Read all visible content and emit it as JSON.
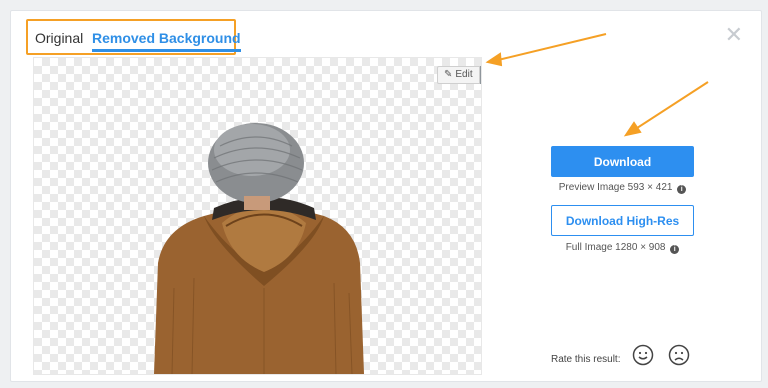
{
  "tabs": {
    "original": "Original",
    "removed": "Removed Background"
  },
  "edit": {
    "label": "Edit"
  },
  "download": {
    "label": "Download",
    "preview_info": "Preview Image 593 × 421"
  },
  "hires": {
    "label": "Download High-Res",
    "full_info": "Full Image 1280 × 908"
  },
  "rate": {
    "label": "Rate this result:"
  },
  "colors": {
    "accent": "#2d8ff0",
    "highlight": "#f5a025"
  },
  "icons": {
    "close": "close-icon",
    "pencil": "pencil-icon",
    "caret": "caret-down-icon",
    "info": "info-icon",
    "happy": "smile-icon",
    "sad": "frown-icon"
  }
}
